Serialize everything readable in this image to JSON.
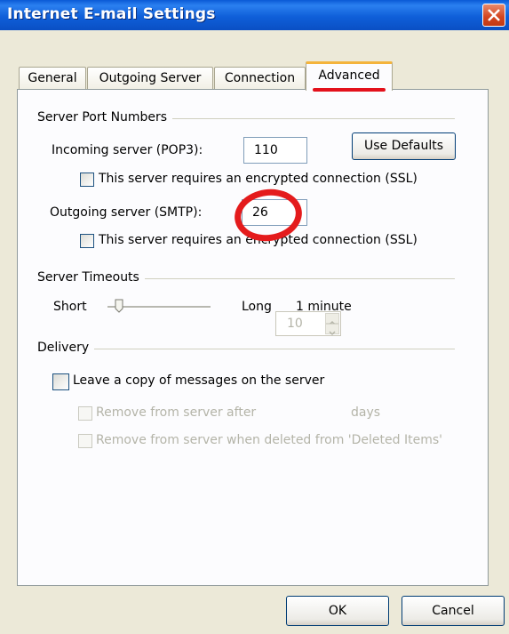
{
  "window": {
    "title": "Internet E-mail Settings"
  },
  "tabs": [
    {
      "label": "General"
    },
    {
      "label": "Outgoing Server"
    },
    {
      "label": "Connection"
    },
    {
      "label": "Advanced"
    }
  ],
  "server_ports": {
    "group_label": "Server Port Numbers",
    "incoming_label": "Incoming server (POP3):",
    "incoming_value": "110",
    "use_defaults_label": "Use Defaults",
    "incoming_ssl_label": "This server requires an encrypted connection (SSL)",
    "outgoing_label": "Outgoing server (SMTP):",
    "outgoing_value": "26",
    "outgoing_ssl_label": "This server requires an encrypted connection (SSL)"
  },
  "timeouts": {
    "group_label": "Server Timeouts",
    "short_label": "Short",
    "long_label": "Long",
    "value_label": "1 minute",
    "slider_level": 0.1
  },
  "delivery": {
    "group_label": "Delivery",
    "leave_copy_label": "Leave a copy of messages on the server",
    "remove_after_label": "Remove from server after",
    "remove_after_value": "10",
    "days_label": "days",
    "remove_deleted_label": "Remove from server when deleted from 'Deleted Items'"
  },
  "buttons": {
    "ok_label": "OK",
    "cancel_label": "Cancel"
  },
  "colors": {
    "titlebar": "#0a5ad6",
    "annotation_red": "#e3111b",
    "active_tab_accent": "#f4b43c",
    "dialog_bg": "#ece9d8"
  }
}
